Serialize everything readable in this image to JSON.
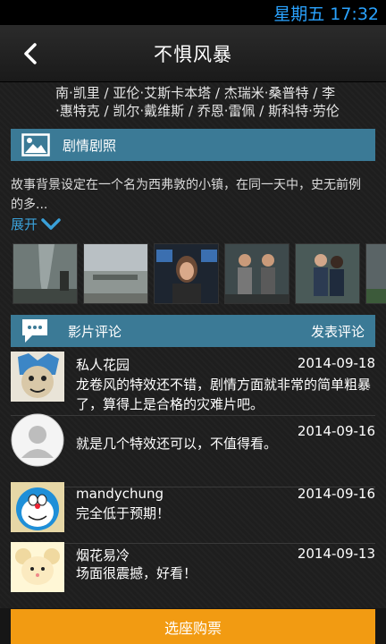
{
  "status_bar": {
    "time_text": "星期五 17:32"
  },
  "header": {
    "title": "不惧风暴"
  },
  "cast_lines": [
    "南·凯里 / 亚伦·艾斯卡本塔 / 杰瑞米·桑普特 / 李",
    "·惠特克 / 凯尔·戴维斯 / 乔恩·雷佩 / 斯科特·劳伦"
  ],
  "plot_section": {
    "title": "剧情剧照",
    "synopsis": "故事背景设定在一个名为西弗敦的小镇，在同一天中，史无前例的多...",
    "expand_label": "展开",
    "stills": [
      "tornado-still",
      "field-still",
      "woman-still",
      "men-still",
      "couple-still",
      "storm-still"
    ]
  },
  "review_section": {
    "title": "影片评论",
    "post_label": "发表评论",
    "reviews": [
      {
        "user": "私人花园",
        "date": "2014-09-18",
        "text": "龙卷风的特效还不错，剧情方面就非常的简单粗暴了，算得上是合格的灾难片吧。",
        "avatar": "blue-creature-avatar"
      },
      {
        "user": "",
        "date": "2014-09-16",
        "text": "就是几个特效还可以，不值得看。",
        "avatar": "default-avatar"
      },
      {
        "user": "mandychung",
        "date": "2014-09-16",
        "text": "完全低于预期！",
        "avatar": "doraemon-avatar"
      },
      {
        "user": "烟花易冷",
        "date": "2014-09-13",
        "text": "场面很震撼，好看！",
        "avatar": "mouse-avatar"
      }
    ]
  },
  "buy_button": {
    "label": "选座购票"
  },
  "colors": {
    "accent": "#3b7a96",
    "link": "#3aa0d8",
    "buy": "#f29b12",
    "status_text": "#2aa3ff"
  }
}
